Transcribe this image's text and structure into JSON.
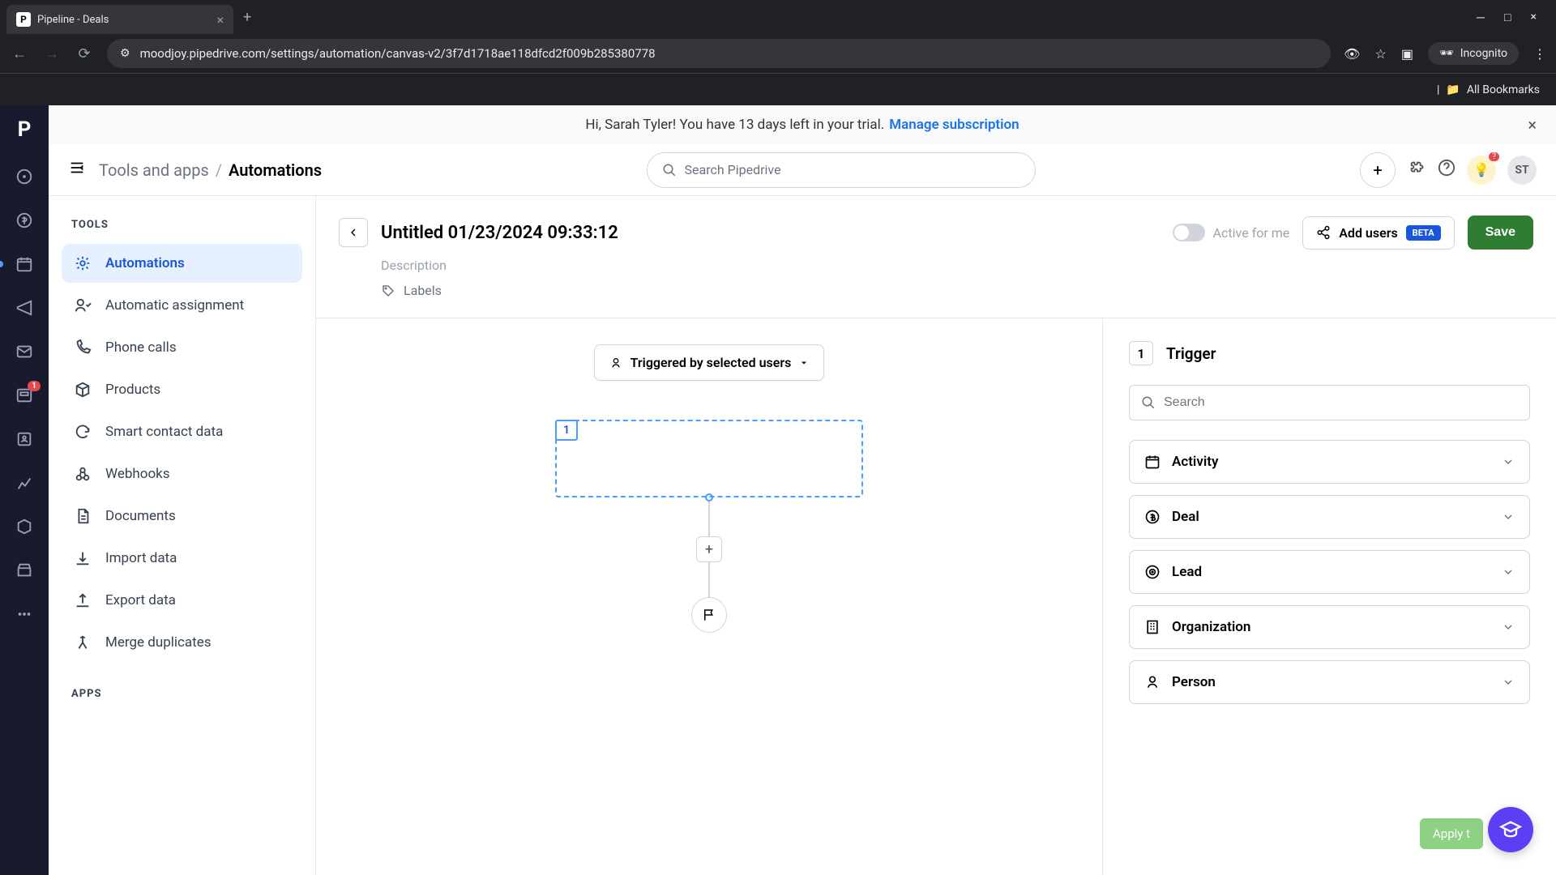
{
  "browser": {
    "tab_title": "Pipeline - Deals",
    "url": "moodjoy.pipedrive.com/settings/automation/canvas-v2/3f7d1718ae118dfcd2f009b285380778",
    "incognito_label": "Incognito",
    "bookmarks_label": "All Bookmarks"
  },
  "banner": {
    "text": "Hi, Sarah Tyler! You have 13 days left in your trial.",
    "link": "Manage subscription"
  },
  "header": {
    "breadcrumb_parent": "Tools and apps",
    "breadcrumb_current": "Automations",
    "search_placeholder": "Search Pipedrive",
    "avatar_initials": "ST",
    "notif_count": "?"
  },
  "sidebar": {
    "heading_tools": "TOOLS",
    "heading_apps": "APPS",
    "items": [
      {
        "label": "Automations"
      },
      {
        "label": "Automatic assignment"
      },
      {
        "label": "Phone calls"
      },
      {
        "label": "Products"
      },
      {
        "label": "Smart contact data"
      },
      {
        "label": "Webhooks"
      },
      {
        "label": "Documents"
      },
      {
        "label": "Import data"
      },
      {
        "label": "Export data"
      },
      {
        "label": "Merge duplicates"
      }
    ]
  },
  "automation": {
    "title": "Untitled 01/23/2024 09:33:12",
    "description_placeholder": "Description",
    "labels_placeholder": "Labels",
    "toggle_label": "Active for me",
    "add_users_label": "Add users",
    "beta_label": "BETA",
    "save_label": "Save",
    "trigger_dropdown": "Triggered by selected users",
    "node_number": "1"
  },
  "panel": {
    "step_num": "1",
    "title": "Trigger",
    "search_placeholder": "Search",
    "items": [
      {
        "label": "Activity"
      },
      {
        "label": "Deal"
      },
      {
        "label": "Lead"
      },
      {
        "label": "Organization"
      },
      {
        "label": "Person"
      }
    ]
  },
  "apply_label": "Apply t",
  "rail_badge": "1"
}
